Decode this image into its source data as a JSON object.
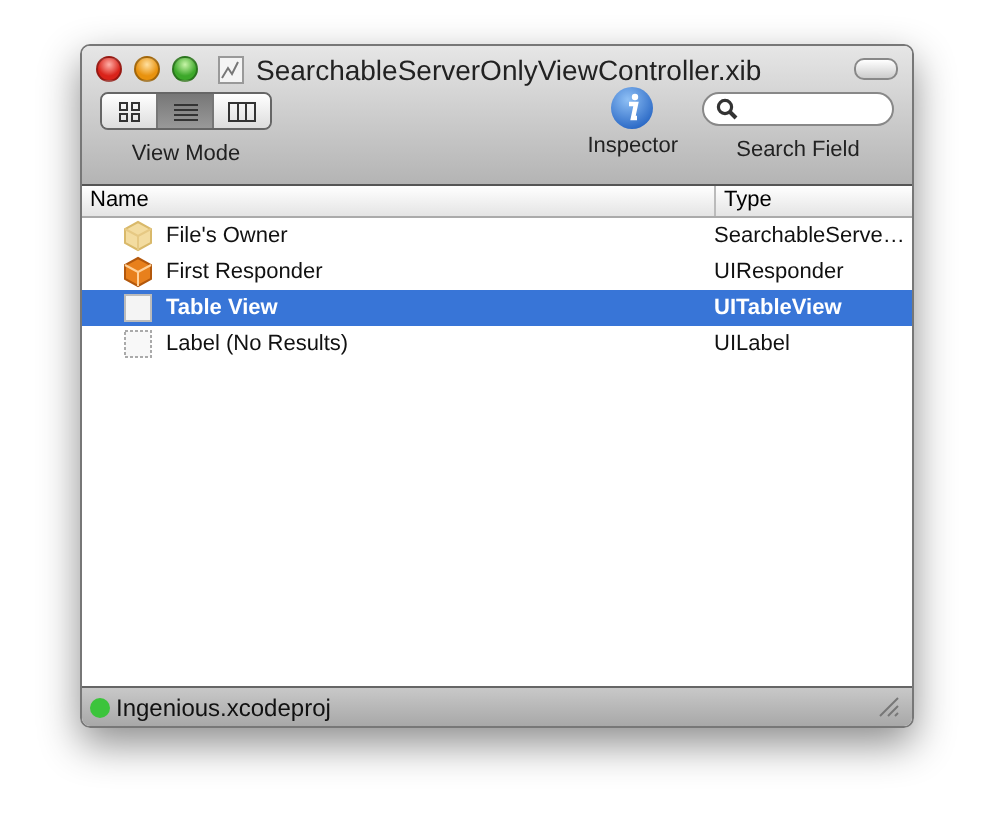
{
  "window": {
    "title": "SearchableServerOnlyViewController.xib"
  },
  "toolbar": {
    "view_mode": {
      "label": "View Mode",
      "segments": [
        {
          "kind": "icons",
          "selected": false
        },
        {
          "kind": "list",
          "selected": true
        },
        {
          "kind": "columns",
          "selected": false
        }
      ]
    },
    "inspector": {
      "label": "Inspector"
    },
    "search": {
      "label": "Search Field"
    }
  },
  "table": {
    "columns": [
      "Name",
      "Type"
    ],
    "rows": [
      {
        "kind": "owner",
        "name": "File's Owner",
        "type": "SearchableServe…",
        "selected": false
      },
      {
        "kind": "responder",
        "name": "First Responder",
        "type": "UIResponder",
        "selected": false
      },
      {
        "kind": "view",
        "name": "Table View",
        "type": "UITableView",
        "selected": true
      },
      {
        "kind": "label",
        "name": "Label (No Results)",
        "type": "UILabel",
        "selected": false
      }
    ]
  },
  "status_bar": {
    "text": "Ingenious.xcodeproj",
    "color": "#3cc43c"
  }
}
